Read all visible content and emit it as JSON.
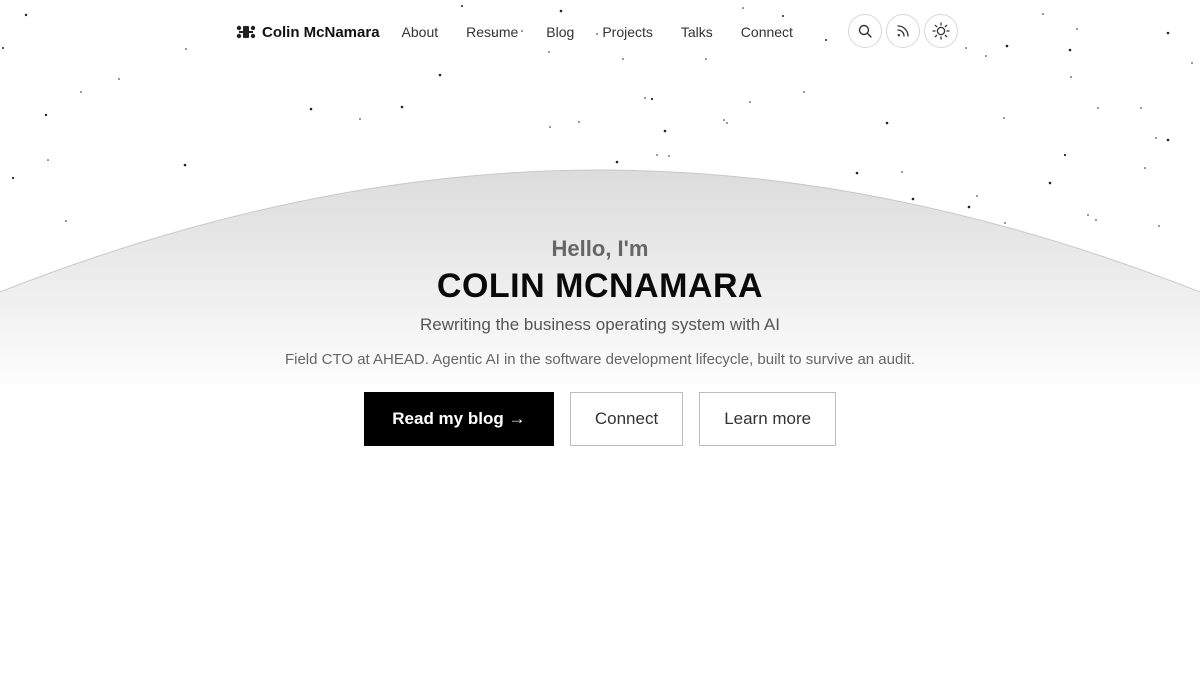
{
  "header": {
    "brand": "Colin McNamara",
    "nav": [
      {
        "label": "About"
      },
      {
        "label": "Resume"
      },
      {
        "label": "Blog"
      },
      {
        "label": "Projects"
      },
      {
        "label": "Talks"
      },
      {
        "label": "Connect"
      }
    ],
    "icons": [
      "search-icon",
      "rss-icon",
      "sun-icon"
    ]
  },
  "hero": {
    "greeting": "Hello, I'm",
    "name": "COLIN MCNAMARA",
    "tagline": "Rewriting the business operating system with AI",
    "description": "Field CTO at AHEAD. Agentic AI in the software development lifecycle, built to survive an audit.",
    "primary_cta": "Read my blog →",
    "secondary_cta": "Connect",
    "tertiary_cta": "Learn more"
  },
  "colors": {
    "background": "#ffffff",
    "text": "#0a0a0a",
    "muted": "#666666",
    "primary_button": "#000000"
  }
}
